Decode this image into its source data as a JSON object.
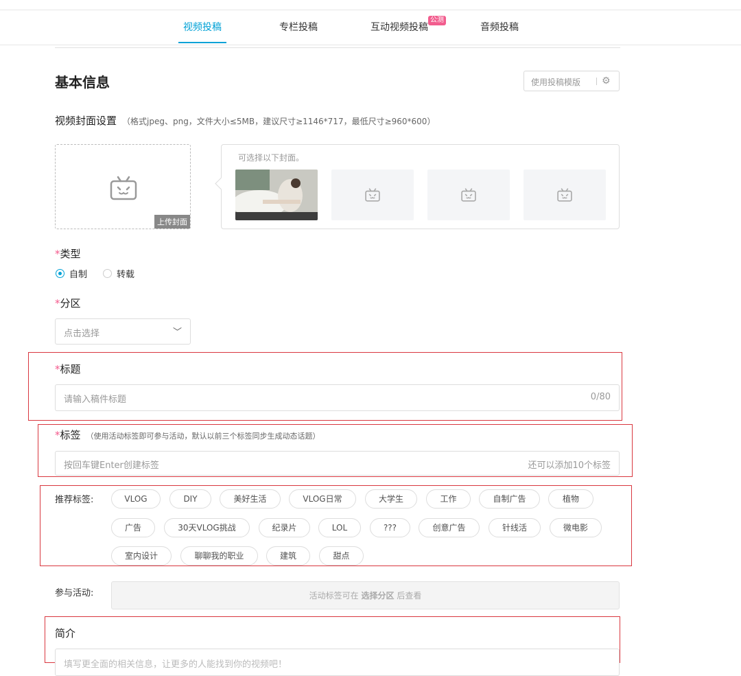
{
  "tabs": [
    {
      "label": "视频投稿",
      "active": true
    },
    {
      "label": "专栏投稿",
      "active": false
    },
    {
      "label": "互动视频投稿",
      "active": false,
      "badge": "公测"
    },
    {
      "label": "音频投稿",
      "active": false
    }
  ],
  "section_title": "基本信息",
  "template_button": {
    "label": "使用投稿模版",
    "icon": "gear-icon"
  },
  "cover": {
    "label": "视频封面设置",
    "hint": "（格式jpeg、png，文件大小≤5MB，建议尺寸≥1146*717，最低尺寸≥960*600）",
    "upload_label": "上传封面",
    "panel_hint": "可选择以下封面。"
  },
  "type": {
    "required": "*",
    "label": "类型",
    "options": [
      {
        "label": "自制",
        "checked": true
      },
      {
        "label": "转载",
        "checked": false
      }
    ]
  },
  "zone": {
    "required": "*",
    "label": "分区",
    "placeholder": "点击选择"
  },
  "title_field": {
    "required": "*",
    "label": "标题",
    "placeholder": "请输入稿件标题",
    "counter": "0/80"
  },
  "tags_field": {
    "required": "*",
    "label": "标签",
    "hint": "（使用活动标签即可参与活动，默认以前三个标签同步生成动态话题）",
    "placeholder": "按回车键Enter创建标签",
    "remaining": "还可以添加10个标签"
  },
  "recommended": {
    "label": "推荐标签:",
    "tags": [
      "VLOG",
      "DIY",
      "美好生活",
      "VLOG日常",
      "大学生",
      "工作",
      "自制广告",
      "植物",
      "广告",
      "30天VLOG挑战",
      "纪录片",
      "LOL",
      "???",
      "创意广告",
      "针线活",
      "微电影",
      "室内设计",
      "聊聊我的职业",
      "建筑",
      "甜点"
    ]
  },
  "activity": {
    "label": "参与活动:",
    "text_pre": "活动标签可在 ",
    "text_bold": "选择分区",
    "text_post": " 后查看"
  },
  "intro": {
    "label": "简介",
    "placeholder": "填写更全面的相关信息，让更多的人能找到你的视频吧！"
  },
  "colors": {
    "accent": "#00a1d6",
    "required": "#f45a8d",
    "highlight_border": "#d9363e",
    "badge": "#f25d8e"
  }
}
